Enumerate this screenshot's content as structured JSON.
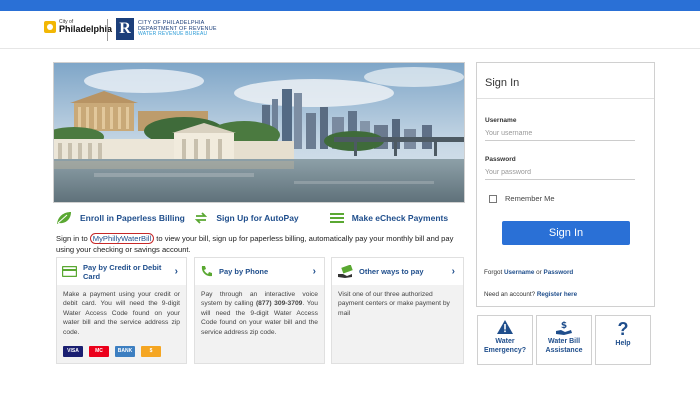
{
  "header": {
    "city_small": "City of",
    "city_name": "Philadelphia",
    "dept_line1": "CITY OF PHILADELPHIA",
    "dept_line2": "DEPARTMENT OF REVENUE",
    "dept_line3": "WATER REVENUE BUREAU"
  },
  "actions": [
    {
      "label": "Enroll in Paperless Billing",
      "icon": "leaf-icon"
    },
    {
      "label": "Sign Up for AutoPay",
      "icon": "autopay-arrows-icon"
    },
    {
      "label": "Make eCheck Payments",
      "icon": "list-icon"
    }
  ],
  "intro": {
    "before": "Sign in to ",
    "link": "MyPhillyWaterBill",
    "after": " to view your bill, sign up for paperless billing, automatically pay your monthly bill and pay using your checking or savings account."
  },
  "cards": [
    {
      "title": "Pay by Credit or Debit Card",
      "body": "Make a payment using your credit or debit card. You will need the 9-digit Water Access Code found on your water bill and the service address zip code.",
      "icon": "credit-card-icon"
    },
    {
      "title": "Pay by Phone",
      "body_before": "Pay through an interactive voice system by calling ",
      "phone": "(877) 309-3709",
      "body_after": ". You will need the 9-digit Water Access Code found on your water bill and the service address zip code.",
      "icon": "phone-icon"
    },
    {
      "title": "Other ways to pay",
      "body": "Visit one of our three authorized payment centers or make payment by mail",
      "icon": "cash-hand-icon"
    }
  ],
  "payment_logos": [
    {
      "label": "VISA",
      "color": "#1a1f71"
    },
    {
      "label": "MC",
      "color": "#eb001b"
    },
    {
      "label": "BANK",
      "color": "#3d7fc1"
    },
    {
      "label": "$",
      "color": "#f5a623"
    }
  ],
  "signin": {
    "title": "Sign In",
    "username_label": "Username",
    "username_placeholder": "Your username",
    "password_label": "Password",
    "password_placeholder": "Your password",
    "remember_label": "Remember Me",
    "button_label": "Sign In",
    "forgot_prefix": "Forgot ",
    "forgot_username": "Username",
    "forgot_or": " or ",
    "forgot_password": "Password",
    "account_prefix": "Need an account? ",
    "register_label": "Register here"
  },
  "quick_links": [
    {
      "label": "Water Emergency?",
      "icon": "warning-icon"
    },
    {
      "label": "Water Bill Assistance",
      "icon": "money-hand-icon"
    },
    {
      "label": "Help",
      "icon": "question-icon"
    }
  ],
  "colors": {
    "accent_blue": "#2a70d6",
    "link_blue": "#1f4e8c",
    "green": "#5aa832"
  }
}
